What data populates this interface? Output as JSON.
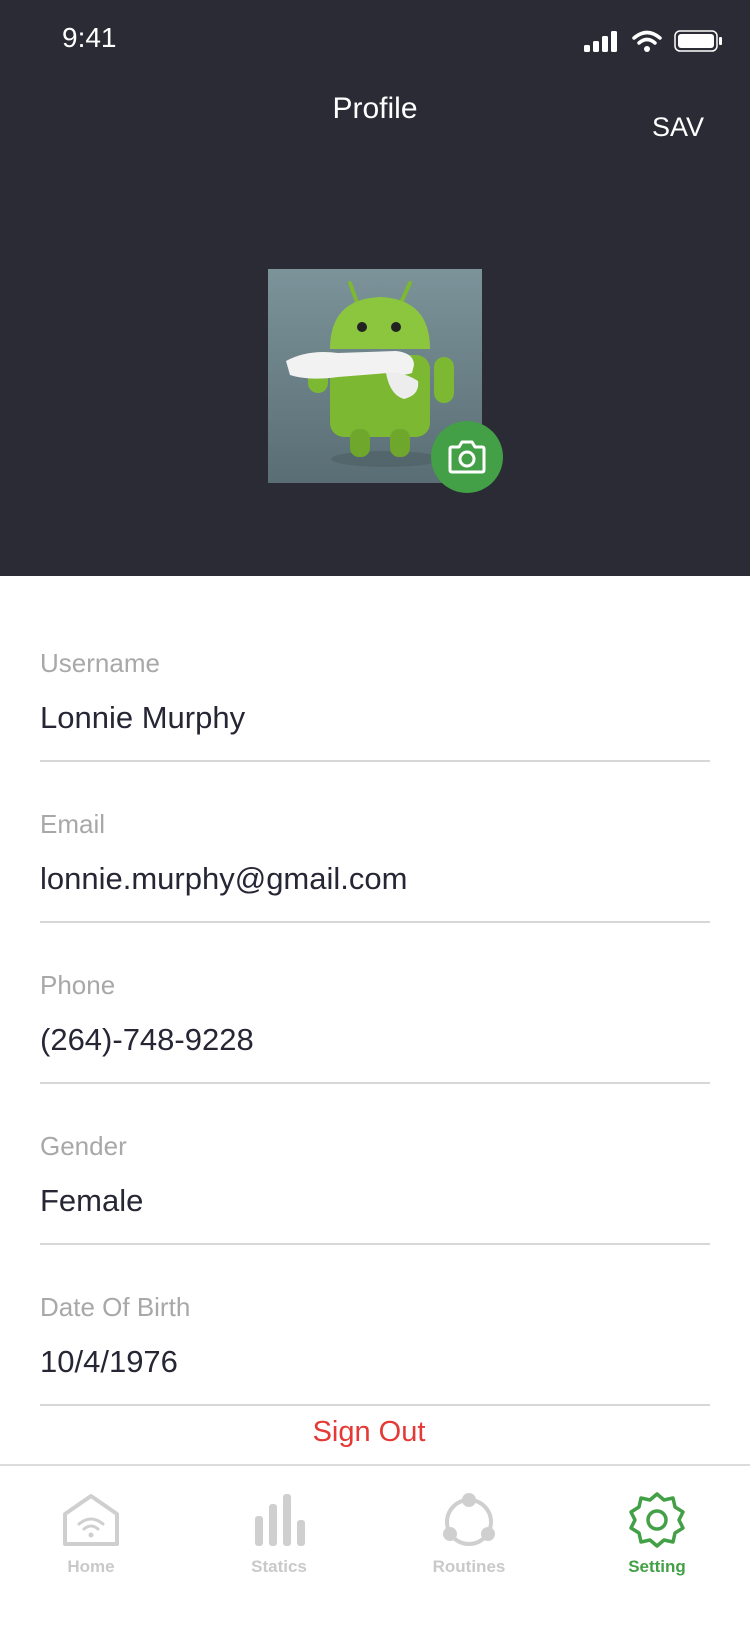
{
  "status_bar": {
    "time": "9:41"
  },
  "header": {
    "title": "Profile",
    "save_label": "SAV"
  },
  "fields": [
    {
      "label": "Username",
      "value": "Lonnie Murphy"
    },
    {
      "label": "Email",
      "value": "lonnie.murphy@gmail.com"
    },
    {
      "label": "Phone",
      "value": "(264)-748-9228"
    },
    {
      "label": "Gender",
      "value": "Female"
    },
    {
      "label": "Date Of Birth",
      "value": "10/4/1976"
    }
  ],
  "sign_out_label": "Sign Out",
  "tabs": [
    {
      "label": "Home",
      "icon": "home-icon"
    },
    {
      "label": "Statics",
      "icon": "bar-chart-icon"
    },
    {
      "label": "Routines",
      "icon": "routines-icon"
    },
    {
      "label": "Setting",
      "icon": "gear-icon",
      "active": true
    }
  ],
  "colors": {
    "header_bg": "#2b2b36",
    "accent": "#43a047",
    "danger": "#e53935"
  }
}
